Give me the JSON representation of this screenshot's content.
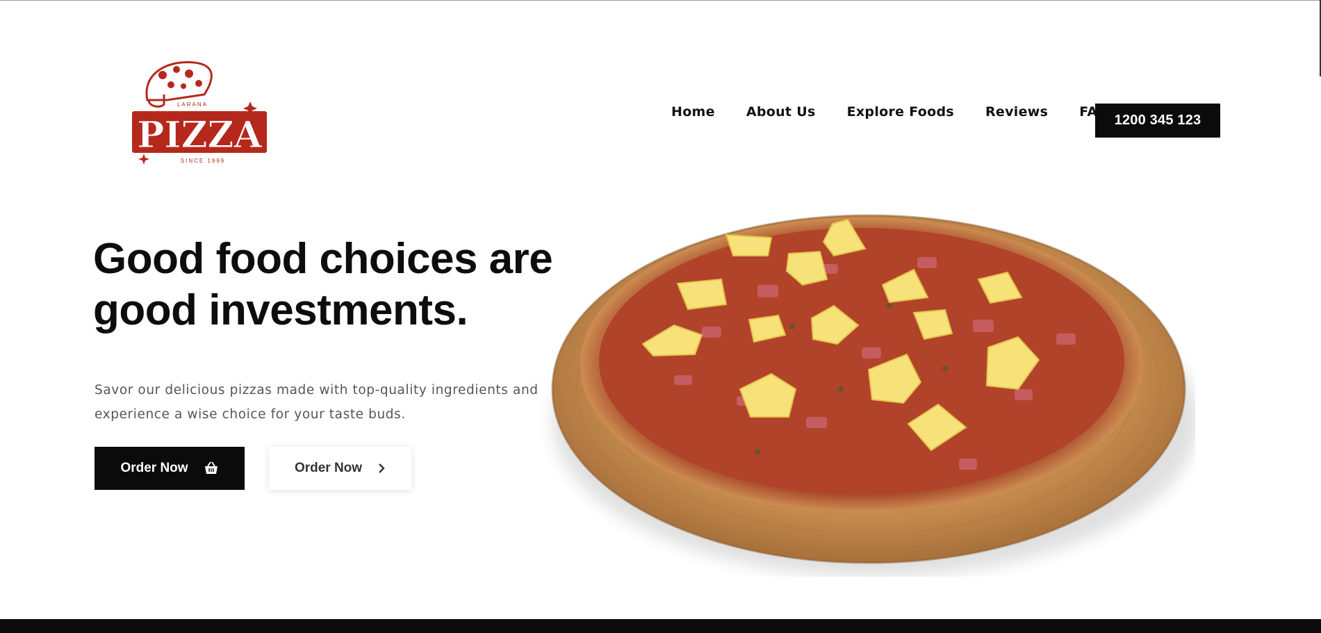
{
  "brand": {
    "top_text": "LARANA",
    "name": "PIZZA",
    "since": "SINCE 1999"
  },
  "nav": {
    "items": [
      "Home",
      "About Us",
      "Explore Foods",
      "Reviews",
      "FAQ"
    ],
    "phone": "1200 345 123"
  },
  "hero": {
    "headline_line1": "Good food choices are",
    "headline_line2": "good investments.",
    "description_line1": "Savor our delicious pizzas made with top-quality ingredients and",
    "description_line2": "experience a wise choice for your taste buds.",
    "primary_button": "Order Now",
    "secondary_button": "Order Now"
  },
  "colors": {
    "brand_red": "#b5291c",
    "dark": "#0b0b0b"
  },
  "icons": {
    "primary_button_icon": "basket-icon",
    "secondary_button_icon": "chevron-right-icon"
  }
}
